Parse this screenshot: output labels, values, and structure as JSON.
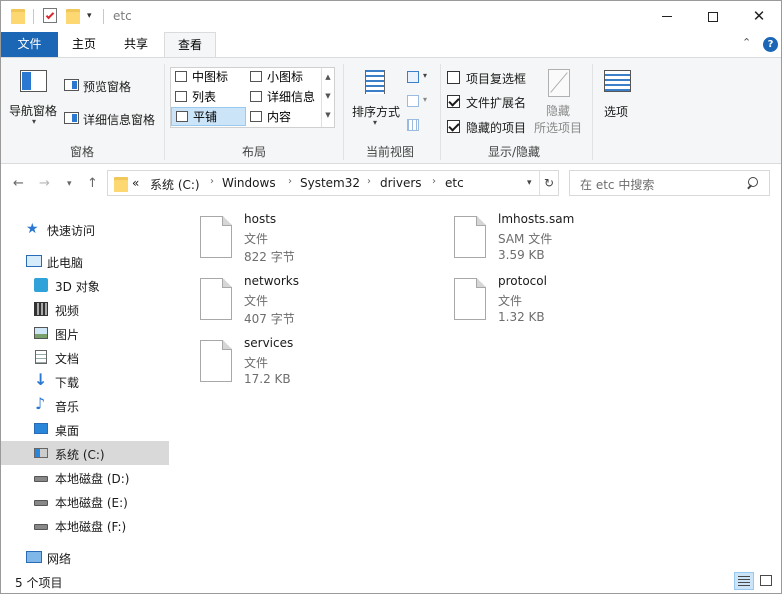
{
  "window": {
    "title": "etc"
  },
  "tabs": {
    "file": "文件",
    "home": "主页",
    "share": "共享",
    "view": "查看"
  },
  "ribbon": {
    "panes": {
      "label": "窗格",
      "nav_pane": "导航窗格",
      "preview_pane": "预览窗格",
      "details_pane": "详细信息窗格"
    },
    "layout": {
      "label": "布局",
      "items": [
        {
          "label": "中图标",
          "selected": false
        },
        {
          "label": "小图标",
          "selected": false
        },
        {
          "label": "列表",
          "selected": false
        },
        {
          "label": "详细信息",
          "selected": false
        },
        {
          "label": "平铺",
          "selected": true
        },
        {
          "label": "内容",
          "selected": false
        }
      ]
    },
    "current_view": {
      "label": "当前视图",
      "sort_by": "排序方式"
    },
    "show_hide": {
      "label": "显示/隐藏",
      "item_checkboxes": {
        "label": "项目复选框",
        "checked": false
      },
      "file_extensions": {
        "label": "文件扩展名",
        "checked": true
      },
      "hidden_items": {
        "label": "隐藏的项目",
        "checked": true
      },
      "hide_selected_line1": "隐藏",
      "hide_selected_line2": "所选项目"
    },
    "options": "选项"
  },
  "address": {
    "overflow": "«",
    "crumbs": [
      "系统 (C:)",
      "Windows",
      "System32",
      "drivers",
      "etc"
    ],
    "search_placeholder": "在 etc 中搜索"
  },
  "nav": {
    "quick_access": "快速访问",
    "this_pc": "此电脑",
    "items": [
      {
        "label": "3D 对象",
        "icon": "3d-objects-icon"
      },
      {
        "label": "视频",
        "icon": "video-icon"
      },
      {
        "label": "图片",
        "icon": "pictures-icon"
      },
      {
        "label": "文档",
        "icon": "documents-icon"
      },
      {
        "label": "下载",
        "icon": "download-icon"
      },
      {
        "label": "音乐",
        "icon": "music-icon"
      },
      {
        "label": "桌面",
        "icon": "desktop-icon"
      },
      {
        "label": "系统 (C:)",
        "icon": "system-drive-icon",
        "selected": true
      },
      {
        "label": "本地磁盘 (D:)",
        "icon": "drive-icon"
      },
      {
        "label": "本地磁盘 (E:)",
        "icon": "drive-icon"
      },
      {
        "label": "本地磁盘 (F:)",
        "icon": "drive-icon"
      }
    ],
    "network": "网络"
  },
  "files": [
    {
      "name": "hosts",
      "type": "文件",
      "size": "822 字节"
    },
    {
      "name": "lmhosts.sam",
      "type": "SAM 文件",
      "size": "3.59 KB"
    },
    {
      "name": "networks",
      "type": "文件",
      "size": "407 字节"
    },
    {
      "name": "protocol",
      "type": "文件",
      "size": "1.32 KB"
    },
    {
      "name": "services",
      "type": "文件",
      "size": "17.2 KB"
    }
  ],
  "status": {
    "count": "5 个项目"
  },
  "colors": {
    "accent": "#1c66b6",
    "selection": "#cce4f7",
    "nav_selected": "#d9d9d9"
  }
}
